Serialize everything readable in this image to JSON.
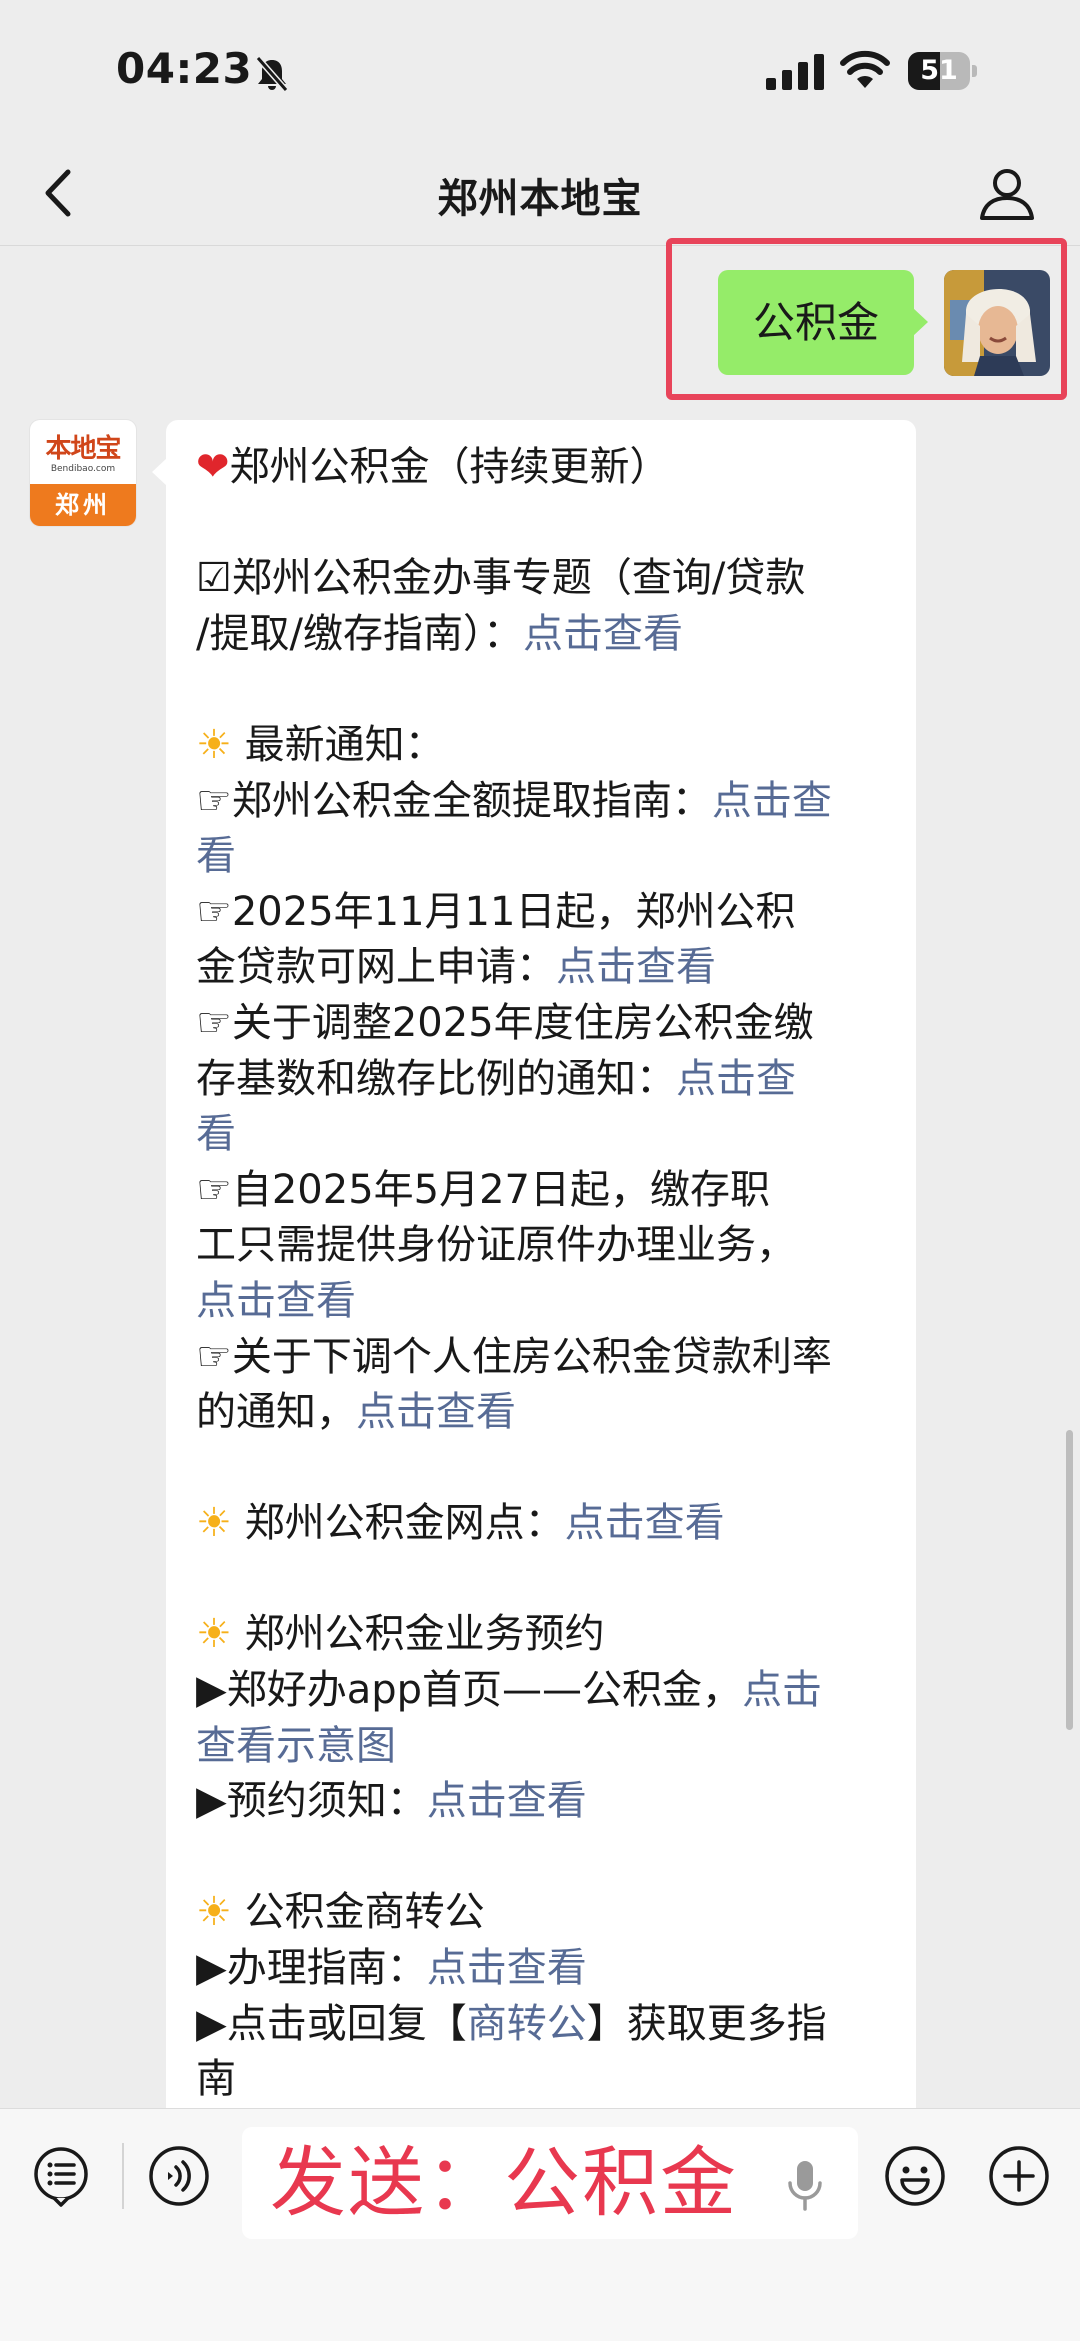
{
  "status_bar": {
    "time": "04:23",
    "battery_level": "51"
  },
  "nav": {
    "title": "郑州本地宝"
  },
  "my_message": {
    "text": "公积金"
  },
  "bot": {
    "avatar": {
      "brand": "本地宝",
      "url": "Bendibao.com",
      "city": "郑州"
    }
  },
  "reply": {
    "title": "郑州公积金（持续更新）",
    "topic_line1": "☑郑州公积金办事专题（查询/贷款",
    "topic_line2": "/提取/缴存指南）：",
    "link_text": "点击查看",
    "latest_heading": " 最新通知：",
    "n1_text": "☞郑州公积金全额提取指南：",
    "n1_link1": "点击查",
    "n1_link2": "看",
    "n2_line1": "☞2025年11月11日起，郑州公积",
    "n2_line2": "金贷款可网上申请：",
    "n3_line1": "☞关于调整2025年度住房公积金缴",
    "n3_line2": "存基数和缴存比例的通知：",
    "n3_link1": "点击查",
    "n3_link2": "看",
    "n4_line1": "☞自2025年5月27日起，缴存职",
    "n4_line2": "工只需提供身份证原件办理业务，",
    "n5_line1": "☞关于下调个人住房公积金贷款利率",
    "n5_line2": "的通知，",
    "outlets_heading": " 郑州公积金网点：",
    "booking_heading": " 郑州公积金业务预约",
    "b1_text": "▶郑好办app首页——公积金，",
    "b1_link1": "点击",
    "b1_link2": "查看示意图",
    "b2_text": "▶预约须知：",
    "transfer_heading": " 公积金商转公",
    "t1_text": "▶办理指南：",
    "t2_pre": "▶点击或回复【",
    "t2_link": "商转公",
    "t2_post": "】获取更多指",
    "t2_line2": "南"
  },
  "input": {
    "value": "发送：公积金"
  },
  "icons": {
    "bell": "bell-slash-icon",
    "signal": "signal-icon",
    "wifi": "wifi-icon",
    "back": "chevron-left-icon",
    "profile": "person-icon",
    "heart": "heart-icon",
    "sun": "sun-icon",
    "menu": "menu-icon",
    "voice": "voice-icon",
    "mic": "microphone-icon",
    "emoji": "emoji-icon",
    "plus": "plus-icon"
  },
  "colors": {
    "my_bubble": "#95ec69",
    "link": "#576b95",
    "highlight": "#e8445a",
    "input_text": "#e8384f",
    "brand_orange": "#ee7a1e"
  }
}
